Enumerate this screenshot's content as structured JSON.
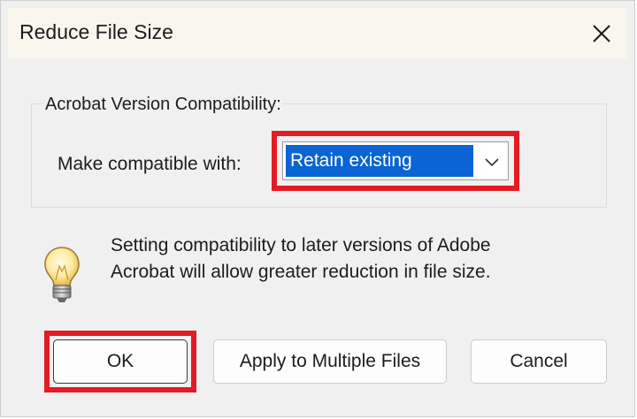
{
  "dialog": {
    "title": "Reduce File Size",
    "close_icon": "close-icon"
  },
  "compatibility": {
    "group_label": "Acrobat Version Compatibility:",
    "field_label": "Make compatible with:",
    "selected_value": "Retain existing",
    "dropdown_icon": "chevron-down-icon"
  },
  "info": {
    "icon": "lightbulb-icon",
    "line1": "Setting compatibility to later versions of Adobe",
    "line2": "Acrobat will allow greater reduction in file size."
  },
  "buttons": {
    "ok": "OK",
    "apply": "Apply to Multiple Files",
    "cancel": "Cancel"
  },
  "colors": {
    "highlight": "#e31b23",
    "selection": "#0a64d4",
    "titlebar": "#f9f6ee",
    "background": "#f0f0f0"
  }
}
